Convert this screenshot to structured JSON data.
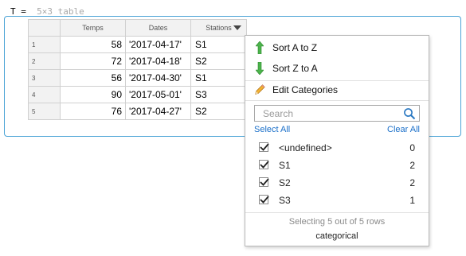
{
  "workspace": {
    "var_name": "T",
    "equals": "=",
    "summary": "5×3 table"
  },
  "table": {
    "headers": [
      "Temps",
      "Dates",
      "Stations"
    ],
    "rows": [
      {
        "n": "1",
        "temps": "58",
        "dates": "'2017-04-17'",
        "stations": "S1"
      },
      {
        "n": "2",
        "temps": "72",
        "dates": "'2017-04-18'",
        "stations": "S2"
      },
      {
        "n": "3",
        "temps": "56",
        "dates": "'2017-04-30'",
        "stations": "S1"
      },
      {
        "n": "4",
        "temps": "90",
        "dates": "'2017-05-01'",
        "stations": "S3"
      },
      {
        "n": "5",
        "temps": "76",
        "dates": "'2017-04-27'",
        "stations": "S2"
      }
    ]
  },
  "menu": {
    "sort_az": "Sort A to Z",
    "sort_za": "Sort Z to A",
    "edit_categories": "Edit Categories",
    "search_placeholder": "Search",
    "select_all": "Select All",
    "clear_all": "Clear All",
    "items": [
      {
        "label": "<undefined>",
        "count": "0",
        "checked": true
      },
      {
        "label": "S1",
        "count": "2",
        "checked": true
      },
      {
        "label": "S2",
        "count": "2",
        "checked": true
      },
      {
        "label": "S3",
        "count": "1",
        "checked": true
      }
    ],
    "status": "Selecting 5 out of 5 rows",
    "type": "categorical"
  },
  "colors": {
    "accent_border": "#4aa3d6",
    "link": "#1a6fc9",
    "sort_arrow": "#3aa53a"
  }
}
